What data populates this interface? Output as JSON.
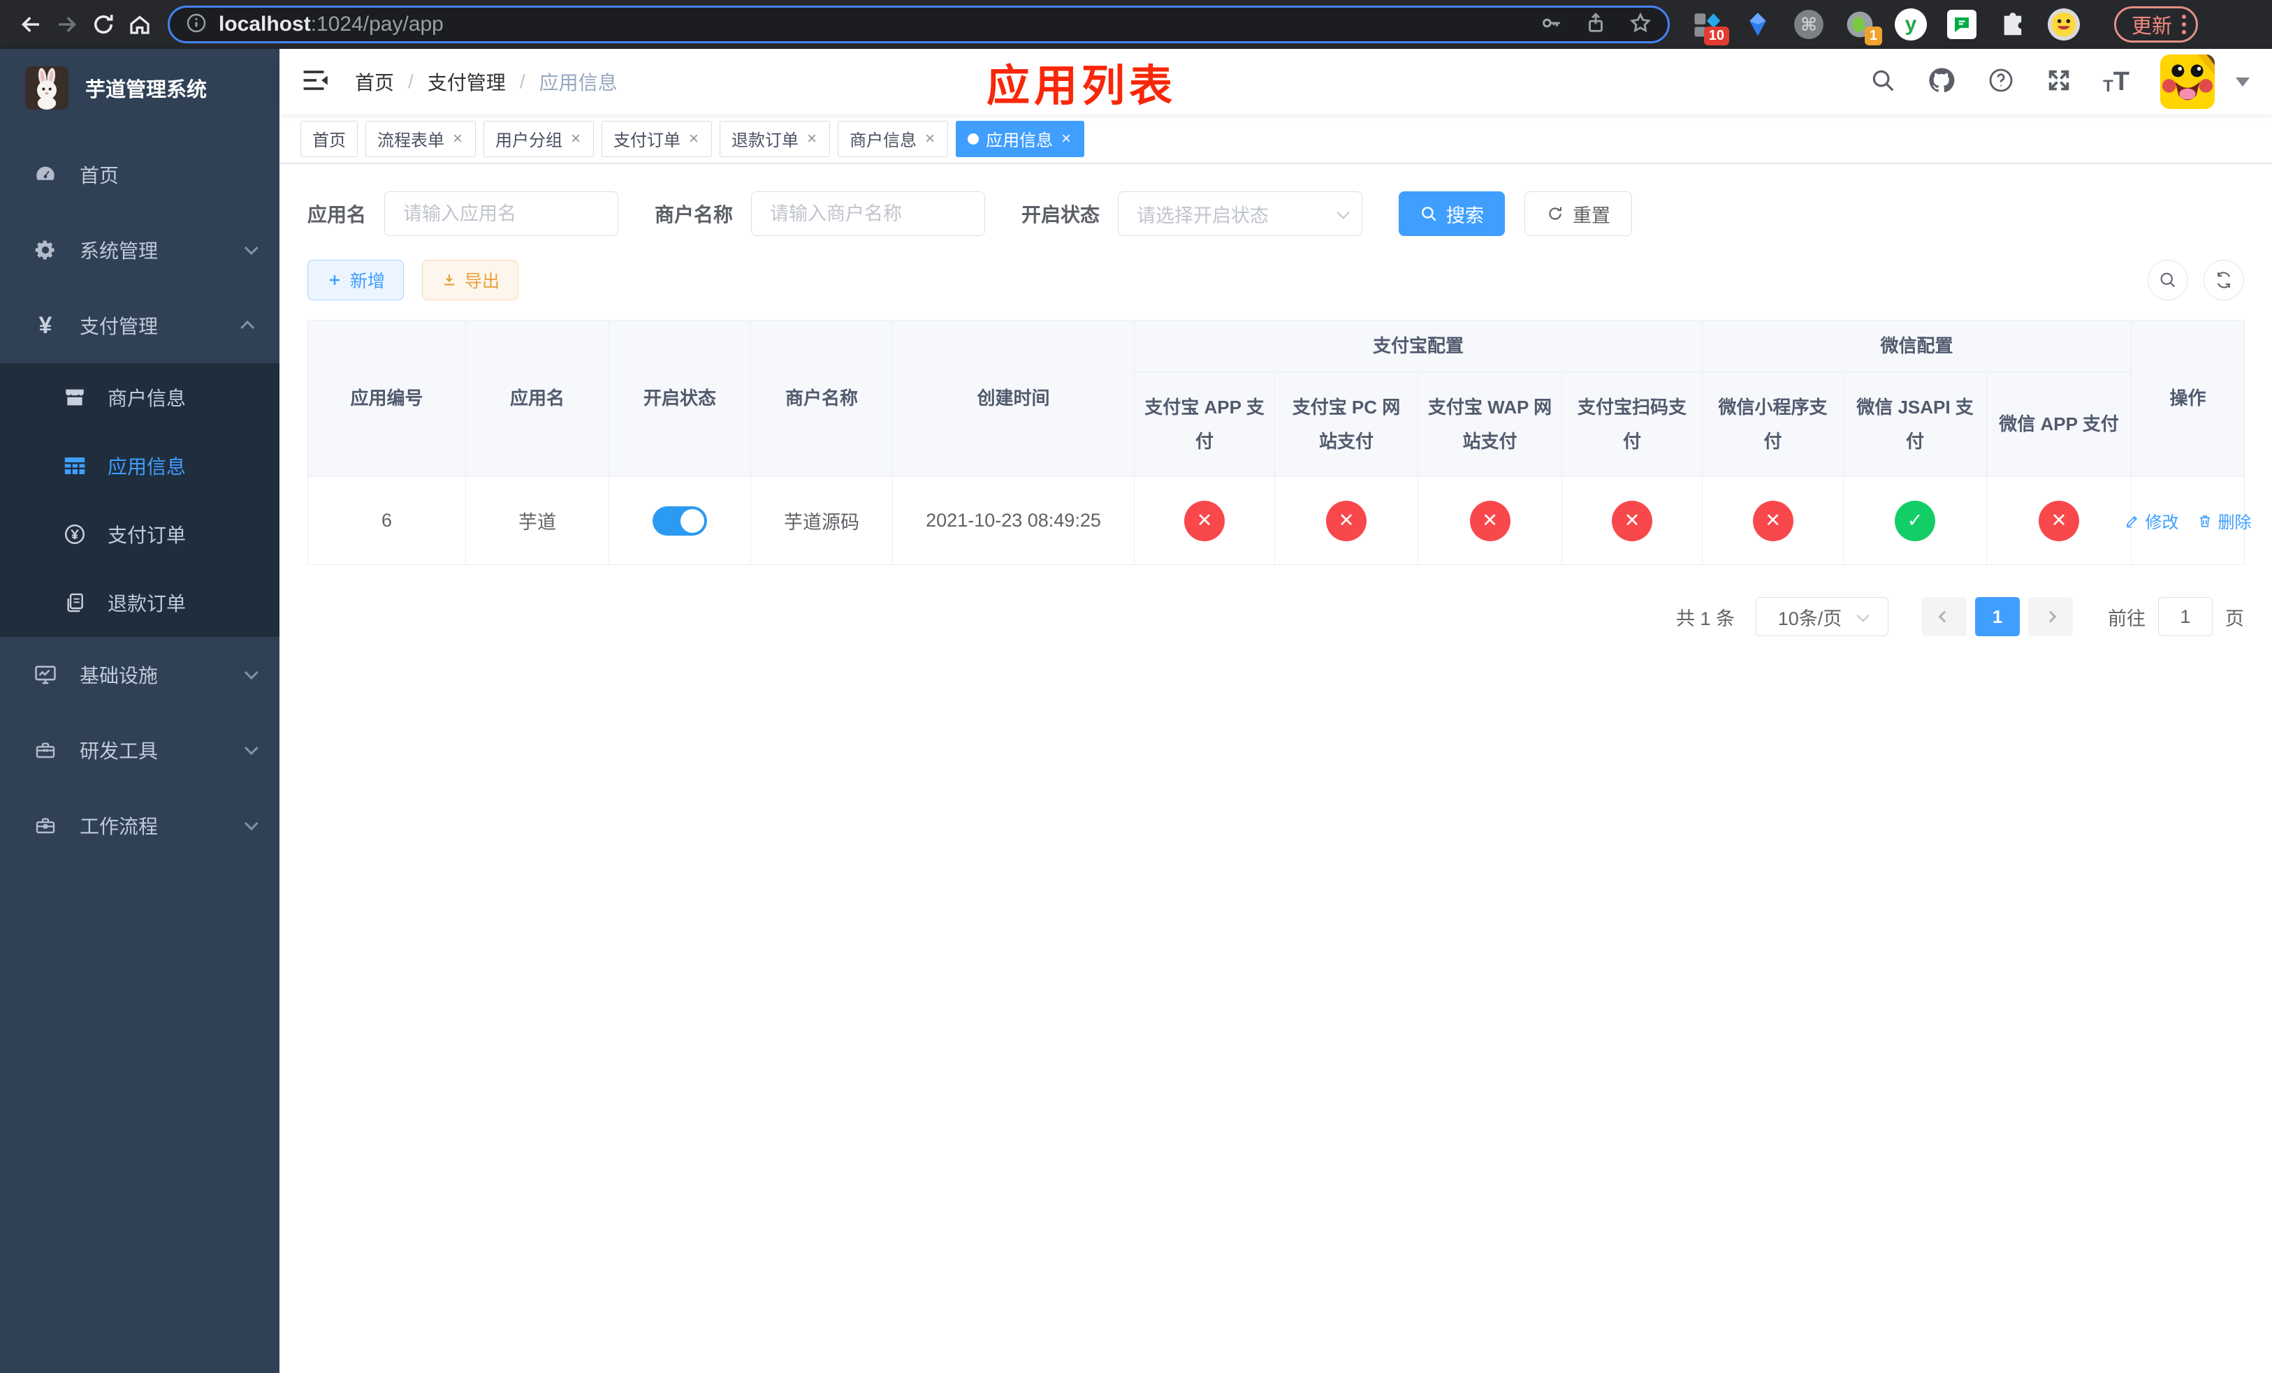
{
  "colors": {
    "accent": "#409eff",
    "success": "#13ce66",
    "danger": "#f8484c",
    "warning": "#e6a23c",
    "sidebar_bg": "#304156",
    "submenu_bg": "#1f2d3d",
    "annotation_red": "#f8270a"
  },
  "browser": {
    "url_host": "localhost",
    "url_path": ":1024/pay/app",
    "update_label": "更新",
    "ext_badge_red": "10",
    "ext_badge_orange": "1"
  },
  "sidebar": {
    "title": "芋道管理系统",
    "items": {
      "home": "首页",
      "system": "系统管理",
      "payment": "支付管理",
      "merchant": "商户信息",
      "app_info": "应用信息",
      "pay_order": "支付订单",
      "refund_order": "退款订单",
      "infra": "基础设施",
      "dev_tools": "研发工具",
      "workflow": "工作流程"
    }
  },
  "navbar": {
    "breadcrumb_home": "首页",
    "breadcrumb_section": "支付管理",
    "breadcrumb_current": "应用信息",
    "annotation": "应用列表"
  },
  "tags": [
    {
      "label": "首页",
      "closable": false,
      "active": false
    },
    {
      "label": "流程表单",
      "closable": true,
      "active": false
    },
    {
      "label": "用户分组",
      "closable": true,
      "active": false
    },
    {
      "label": "支付订单",
      "closable": true,
      "active": false
    },
    {
      "label": "退款订单",
      "closable": true,
      "active": false
    },
    {
      "label": "商户信息",
      "closable": true,
      "active": false
    },
    {
      "label": "应用信息",
      "closable": true,
      "active": true
    }
  ],
  "filters": {
    "app_name_label": "应用名",
    "app_name_placeholder": "请输入应用名",
    "merchant_label": "商户名称",
    "merchant_placeholder": "请输入商户名称",
    "status_label": "开启状态",
    "status_placeholder": "请选择开启状态",
    "search_label": "搜索",
    "reset_label": "重置"
  },
  "toolbar": {
    "add_label": "新增",
    "export_label": "导出"
  },
  "table": {
    "col_app_id": "应用编号",
    "col_app_name": "应用名",
    "col_status": "开启状态",
    "col_merchant": "商户名称",
    "col_created": "创建时间",
    "group_alipay": "支付宝配置",
    "group_wechat": "微信配置",
    "cols": [
      "支付宝 APP 支付",
      "支付宝 PC 网站支付",
      "支付宝 WAP 网站支付",
      "支付宝扫码支付",
      "微信小程序支付",
      "微信 JSAPI 支付",
      "微信 APP 支付"
    ],
    "col_actions": "操作",
    "row": {
      "id": "6",
      "name": "芋道",
      "status": "on",
      "merchant": "芋道源码",
      "created": "2021-10-23 08:49:25",
      "channels": [
        {
          "name": "alipay-app-pay",
          "state": "off",
          "glyph": "✕"
        },
        {
          "name": "alipay-pc-pay",
          "state": "off",
          "glyph": "✕"
        },
        {
          "name": "alipay-wap-pay",
          "state": "off",
          "glyph": "✕"
        },
        {
          "name": "alipay-qr-pay",
          "state": "off",
          "glyph": "✕"
        },
        {
          "name": "wechat-lite-pay",
          "state": "off",
          "glyph": "✕"
        },
        {
          "name": "wechat-jsapi-pay",
          "state": "on",
          "glyph": "✓"
        },
        {
          "name": "wechat-app-pay",
          "state": "off",
          "glyph": "✕"
        }
      ],
      "edit_label": "修改",
      "delete_label": "删除"
    }
  },
  "pagination": {
    "total": "共 1 条",
    "page_size": "10条/页",
    "page": "1",
    "goto_label": "前往",
    "goto_value": "1",
    "unit_label": "页"
  }
}
